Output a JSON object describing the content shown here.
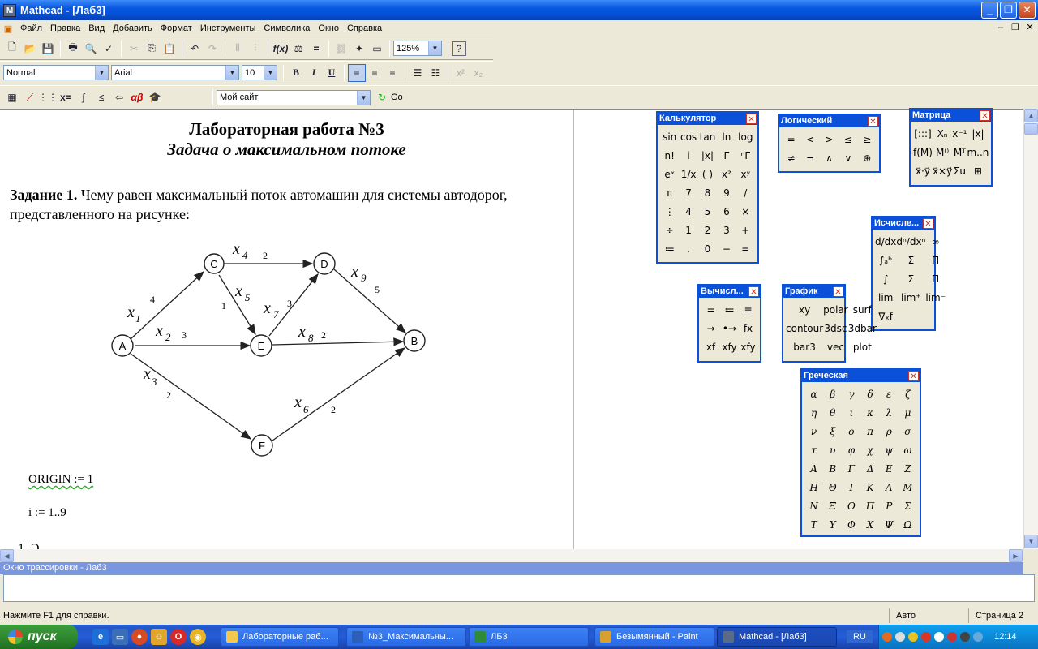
{
  "window": {
    "title": "Mathcad - [Лаб3]",
    "app_icon": "M"
  },
  "menu": [
    "Файл",
    "Правка",
    "Вид",
    "Добавить",
    "Формат",
    "Инструменты",
    "Символика",
    "Окно",
    "Справка"
  ],
  "toolbar": {
    "zoom": "125%",
    "style": "Normal",
    "font": "Arial",
    "size": "10",
    "bold": "B",
    "italic": "I",
    "underline": "U",
    "address": "Мой сайт",
    "go": "Go"
  },
  "document": {
    "title": "Лабораторная работа №3",
    "subtitle": "Задача о максимальном потоке",
    "task_bold": "Задание 1.",
    "task_text": " Чему равен максимальный поток автомашин для системы автодорог, представленного на рисунке:",
    "graph": {
      "nodes": [
        "A",
        "B",
        "C",
        "D",
        "E",
        "F"
      ],
      "edges": [
        {
          "var": "x",
          "sub": "1",
          "cap": "4"
        },
        {
          "var": "x",
          "sub": "2",
          "cap": "3"
        },
        {
          "var": "x",
          "sub": "3",
          "cap": "2"
        },
        {
          "var": "x",
          "sub": "4",
          "cap": "2"
        },
        {
          "var": "x",
          "sub": "5",
          "cap": "1"
        },
        {
          "var": "x",
          "sub": "6",
          "cap": "2"
        },
        {
          "var": "x",
          "sub": "7",
          "cap": "3"
        },
        {
          "var": "x",
          "sub": "8",
          "cap": "2"
        },
        {
          "var": "x",
          "sub": "9",
          "cap": "5"
        }
      ]
    },
    "origin": "ORIGIN := 1",
    "range": "i := 1..9",
    "partial": "1. Э"
  },
  "trace_title": "Окно трассировки - Лаб3",
  "status": {
    "help": "Нажмите F1 для справки.",
    "mode": "Авто",
    "page": "Страница 2"
  },
  "palettes": {
    "calculator": {
      "title": "Калькулятор",
      "items": [
        "sin",
        "cos",
        "tan",
        "ln",
        "log",
        "n!",
        "i",
        "|x|",
        "Γ",
        "ⁿΓ",
        "eˣ",
        "1/x",
        "( )",
        "x²",
        "xʸ",
        "π",
        "7",
        "8",
        "9",
        "/",
        "⋮",
        "4",
        "5",
        "6",
        "×",
        "÷",
        "1",
        "2",
        "3",
        "+",
        "≔",
        ".",
        "0",
        "−",
        "="
      ]
    },
    "boolean": {
      "title": "Логический",
      "items": [
        "=",
        "<",
        ">",
        "≤",
        "≥",
        "≠",
        "¬",
        "∧",
        "∨",
        "⊕"
      ]
    },
    "matrix": {
      "title": "Матрица",
      "items": [
        "[:::]",
        "Xₙ",
        "x⁻¹",
        "|x|",
        "f(M)",
        "M⁽⁾",
        "Mᵀ",
        "m..n",
        "x⃗·y⃗",
        "x⃗×y⃗",
        "Σu",
        "⊞"
      ]
    },
    "calculus": {
      "title": "Исчисле...",
      "items": [
        "d/dx",
        "dⁿ/dxⁿ",
        "∞",
        "∫ₐᵇ",
        "Σ",
        "Π",
        "∫",
        "Σ",
        "Π",
        "lim",
        "lim⁺",
        "lim⁻",
        "∇ₓf"
      ]
    },
    "evaluation": {
      "title": "Вычисл...",
      "items": [
        "=",
        "≔",
        "≡",
        "→",
        "•→",
        "fx",
        "xf",
        "xfy",
        "xfy"
      ]
    },
    "graph": {
      "title": "График",
      "items": [
        "xy",
        "polar",
        "surf",
        "contour",
        "3dsc",
        "3dbar",
        "bar3",
        "vec",
        "plot"
      ]
    },
    "greek": {
      "title": "Греческая",
      "items": [
        "α",
        "β",
        "γ",
        "δ",
        "ε",
        "ζ",
        "η",
        "θ",
        "ι",
        "κ",
        "λ",
        "μ",
        "ν",
        "ξ",
        "ο",
        "π",
        "ρ",
        "σ",
        "τ",
        "υ",
        "φ",
        "χ",
        "ψ",
        "ω",
        "Α",
        "Β",
        "Γ",
        "Δ",
        "Ε",
        "Ζ",
        "Η",
        "Θ",
        "Ι",
        "Κ",
        "Λ",
        "Μ",
        "Ν",
        "Ξ",
        "Ο",
        "Π",
        "Ρ",
        "Σ",
        "Τ",
        "Υ",
        "Φ",
        "Χ",
        "Ψ",
        "Ω"
      ]
    }
  },
  "taskbar": {
    "start": "пуск",
    "buttons": [
      "Лабораторные раб...",
      "№3_Максимальны...",
      "ЛБ3",
      "Безымянный - Paint",
      "Mathcad - [Лаб3]"
    ],
    "lang": "RU",
    "clock": "12:14"
  },
  "colors": {
    "accent": "#0a50d8",
    "taskbar": "#245dd9",
    "start": "#2f8a2f"
  }
}
